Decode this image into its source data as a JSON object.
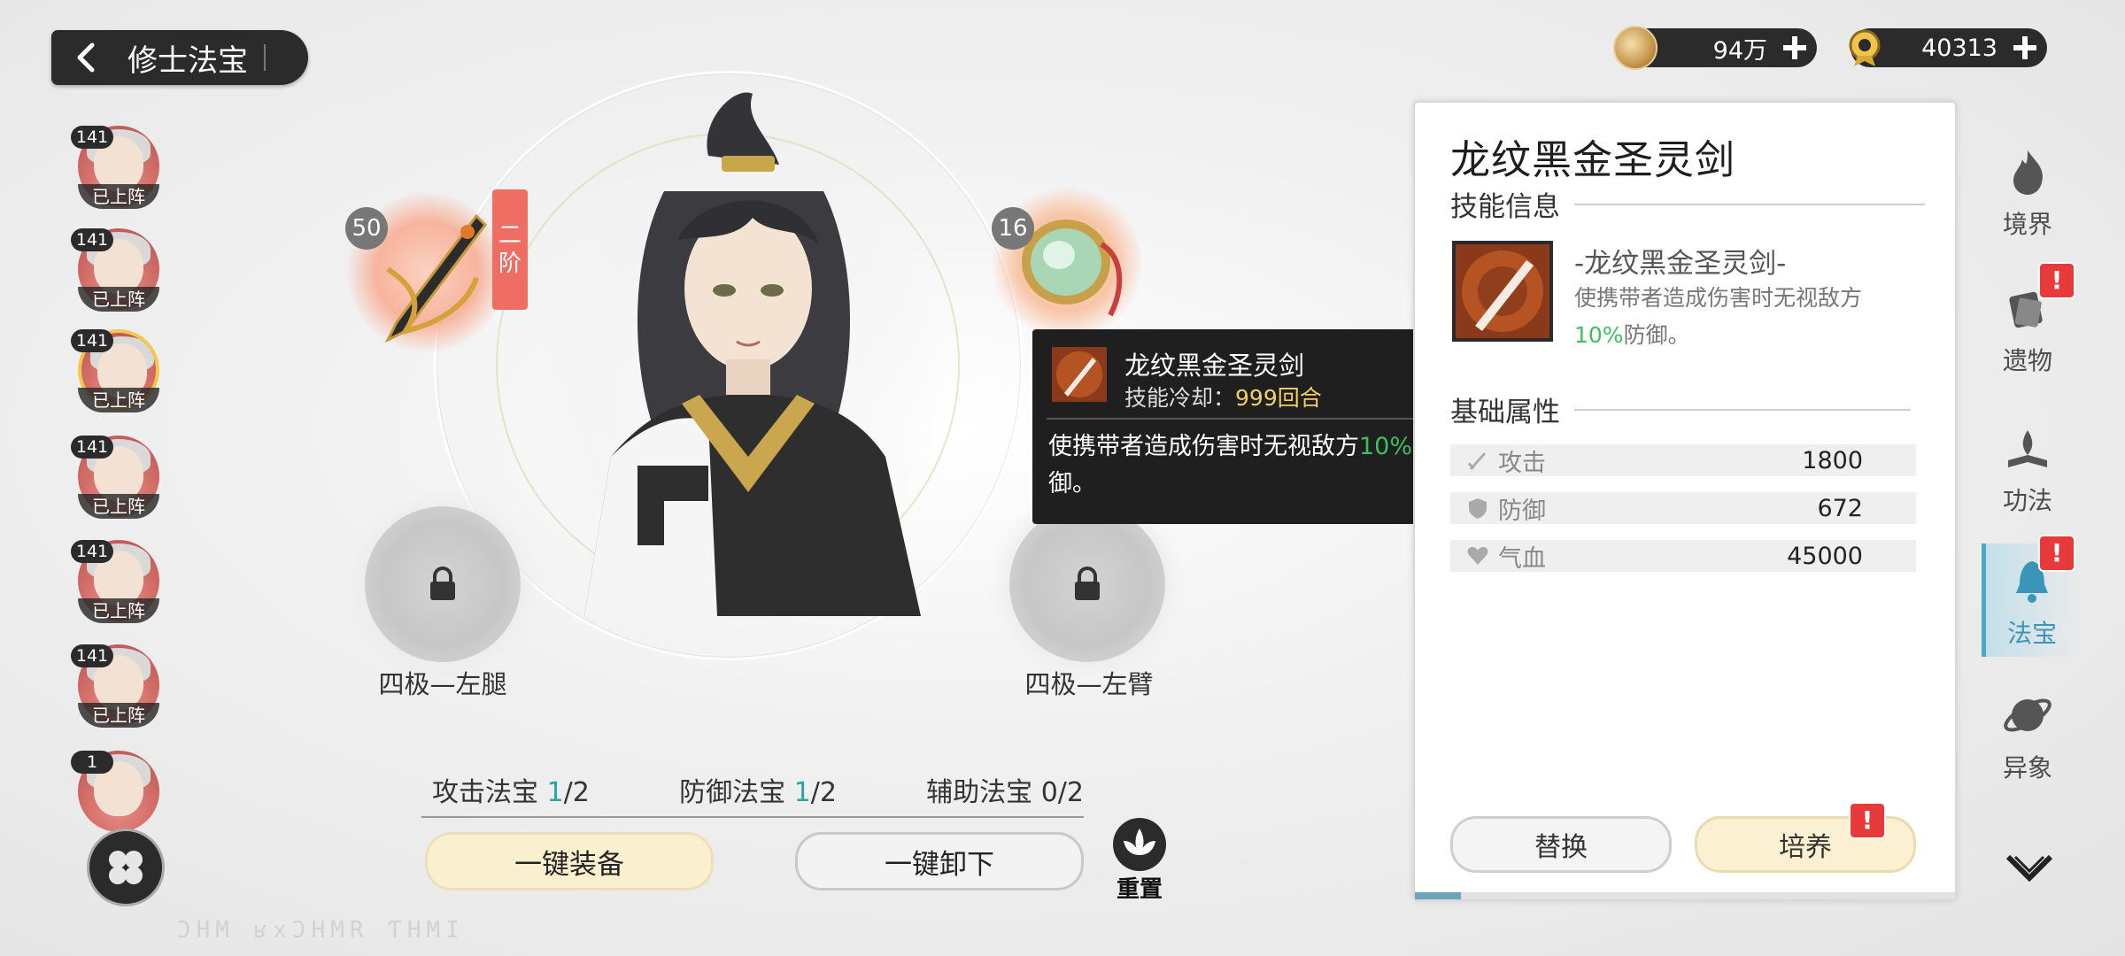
{
  "header": {
    "title": "修士法宝"
  },
  "currency": [
    {
      "value": "94万",
      "icon": "gold-coin-icon"
    },
    {
      "value": "40313",
      "icon": "spirit-stone-icon"
    }
  ],
  "roster": [
    {
      "level": "141",
      "status": "已上阵"
    },
    {
      "level": "141",
      "status": "已上阵"
    },
    {
      "level": "141",
      "status": "已上阵",
      "active": true
    },
    {
      "level": "141",
      "status": "已上阵"
    },
    {
      "level": "141",
      "status": "已上阵"
    },
    {
      "level": "141",
      "status": "已上阵"
    },
    {
      "level": "1",
      "status": ""
    }
  ],
  "slots": {
    "left_top": {
      "level": "50",
      "grade": "二阶"
    },
    "right_top": {
      "level": "16"
    },
    "left_bottom": {
      "name": "四极—左腿"
    },
    "right_bottom": {
      "name": "四极—左臂"
    }
  },
  "tooltip": {
    "name": "龙纹黑金圣灵剑",
    "cooldown_label": "技能冷却：",
    "cooldown_value": "999回合",
    "desc_pre": "使携带者造成伤害时无视敌方",
    "desc_pct": "10%",
    "desc_post": "防御。"
  },
  "panel": {
    "title": "龙纹黑金圣灵剑",
    "skill_section": "技能信息",
    "skill_name": "-龙纹黑金圣灵剑-",
    "skill_desc_pre": "使携带者造成伤害时无视敌方",
    "skill_desc_pct": "10%",
    "skill_desc_post": "防御。",
    "attr_section": "基础属性",
    "stats": [
      {
        "label": "攻击",
        "value": "1800",
        "icon": "sword-icon"
      },
      {
        "label": "防御",
        "value": "672",
        "icon": "shield-icon"
      },
      {
        "label": "气血",
        "value": "45000",
        "icon": "heart-icon"
      }
    ],
    "replace": "替换",
    "cultivate": "培养"
  },
  "nav": [
    {
      "label": "境界",
      "icon": "realm-flame-icon",
      "alert": false
    },
    {
      "label": "遗物",
      "icon": "relic-icon",
      "alert": true
    },
    {
      "label": "功法",
      "icon": "technique-book-icon",
      "alert": false
    },
    {
      "label": "法宝",
      "icon": "treasure-bell-icon",
      "alert": true,
      "active": true
    },
    {
      "label": "异象",
      "icon": "vision-orb-icon",
      "alert": false
    }
  ],
  "categories": [
    {
      "label": "攻击法宝",
      "count": "1",
      "total": "/2"
    },
    {
      "label": "防御法宝",
      "count": "1",
      "total": "/2"
    },
    {
      "label": "辅助法宝",
      "count": "0",
      "total": "/2"
    }
  ],
  "buttons": {
    "equip": "一键装备",
    "unload": "一键卸下",
    "reset": "重置"
  },
  "alert_mark": "!",
  "footer_code": "ƆHM  ʁxƆHMR ƬHMI",
  "colors": {
    "accent_green": "#3fbf5f",
    "alert_red": "#e83a3a",
    "active_nav": "#3a96b8"
  }
}
